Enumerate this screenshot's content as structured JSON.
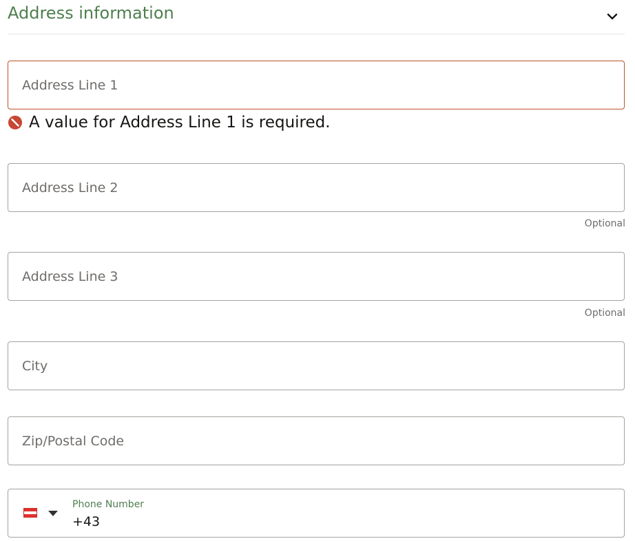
{
  "section": {
    "title": "Address information",
    "toggle_icon": "chevron-down-icon"
  },
  "fields": {
    "address_line_1": {
      "placeholder": "Address Line 1",
      "value": ""
    },
    "address_line_1_error": "A value for Address Line 1 is required.",
    "address_line_2": {
      "placeholder": "Address Line 2",
      "value": "",
      "hint": "Optional"
    },
    "address_line_3": {
      "placeholder": "Address Line 3",
      "value": "",
      "hint": "Optional"
    },
    "city": {
      "placeholder": "City",
      "value": ""
    },
    "zip": {
      "placeholder": "Zip/Postal Code",
      "value": ""
    },
    "phone": {
      "label": "Phone Number",
      "value": "+43",
      "country_icon": "austria-flag-icon"
    }
  },
  "colors": {
    "title_green": "#4e7f4f",
    "error_red": "#b7522c",
    "border_gray": "#a6a39f"
  }
}
